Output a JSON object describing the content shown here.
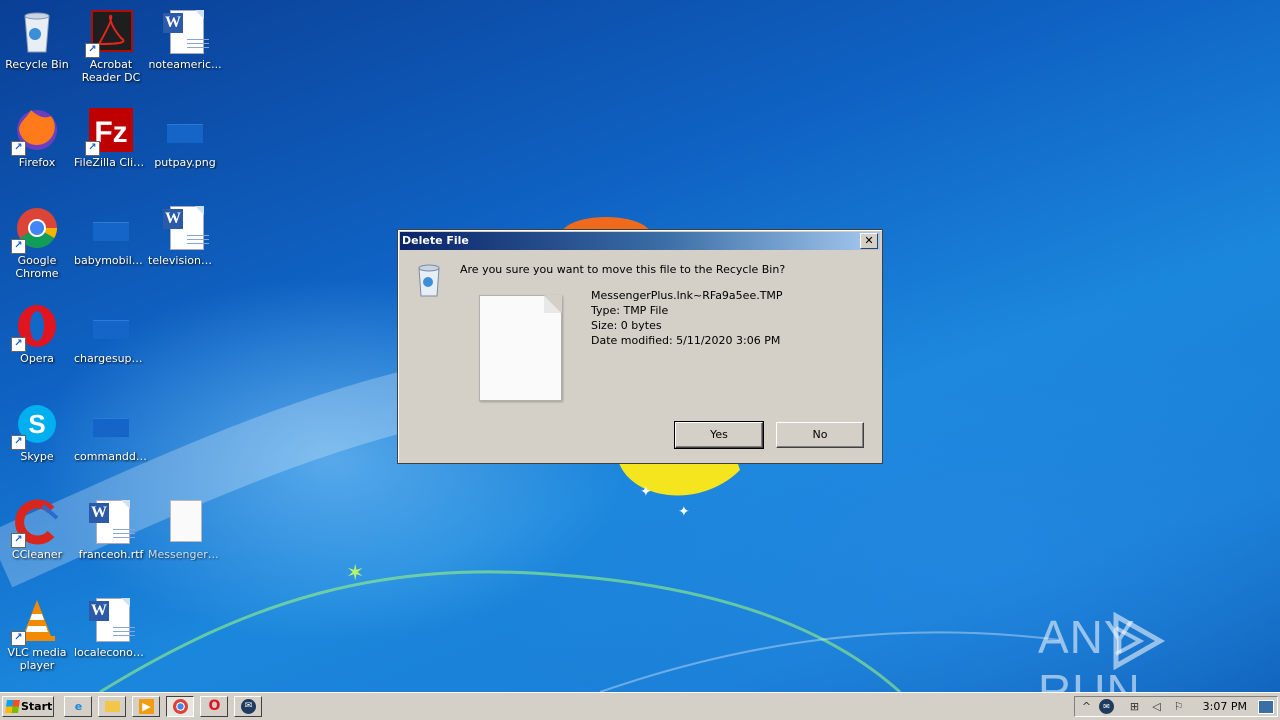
{
  "desktop": {
    "icons": [
      {
        "label": "Recycle Bin"
      },
      {
        "label": "Acrobat Reader DC"
      },
      {
        "label": "noteameric..."
      },
      {
        "label": "Firefox"
      },
      {
        "label": "FileZilla Client"
      },
      {
        "label": "putpay.png"
      },
      {
        "label": "Google Chrome"
      },
      {
        "label": "babymobile...."
      },
      {
        "label": "televisionm..."
      },
      {
        "label": "Opera"
      },
      {
        "label": "chargesupe..."
      },
      {
        "label": "Skype"
      },
      {
        "label": "commanddi..."
      },
      {
        "label": "CCleaner"
      },
      {
        "label": "franceoh.rtf"
      },
      {
        "label": "MessengerP..."
      },
      {
        "label": "VLC media player"
      },
      {
        "label": "localeconom..."
      }
    ]
  },
  "dialog": {
    "title": "Delete File",
    "close_glyph": "✕",
    "question": "Are you sure you want to move this file to the Recycle Bin?",
    "file_name": "MessengerPlus.lnk~RFa9a5ee.TMP",
    "file_type": "Type: TMP File",
    "file_size": "Size: 0 bytes",
    "file_modified": "Date modified: 5/11/2020 3:06 PM",
    "yes_label": "Yes",
    "no_label": "No"
  },
  "taskbar": {
    "start_label": "Start",
    "quicklaunch": [
      "internet-explorer-icon",
      "explorer-folder-icon",
      "media-player-icon",
      "chrome-icon",
      "opera-icon",
      "messenger-icon"
    ],
    "tray_expand": "^",
    "clock": "3:07 PM"
  },
  "watermark": {
    "text_left": "ANY",
    "text_right": "RUN"
  },
  "colors": {
    "title_gradient_start": "#0a246a",
    "title_gradient_end": "#a6caf0",
    "dialog_bg": "#d4d0c8"
  }
}
